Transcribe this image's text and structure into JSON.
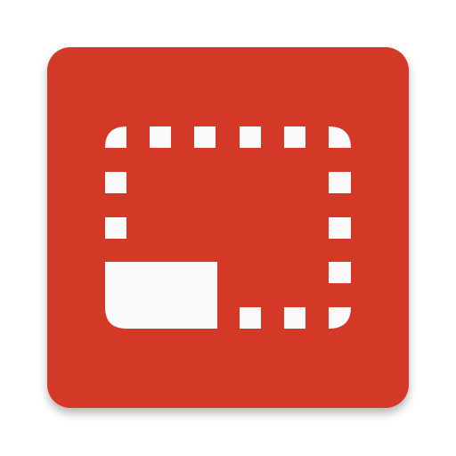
{
  "icon": {
    "semantic": "dashed-frame-corner-tile-icon",
    "colors": {
      "tile": "#D43726",
      "glyph": "#FAFAFA",
      "shadow": "#000000",
      "page_background": "#FFFFFF"
    }
  }
}
